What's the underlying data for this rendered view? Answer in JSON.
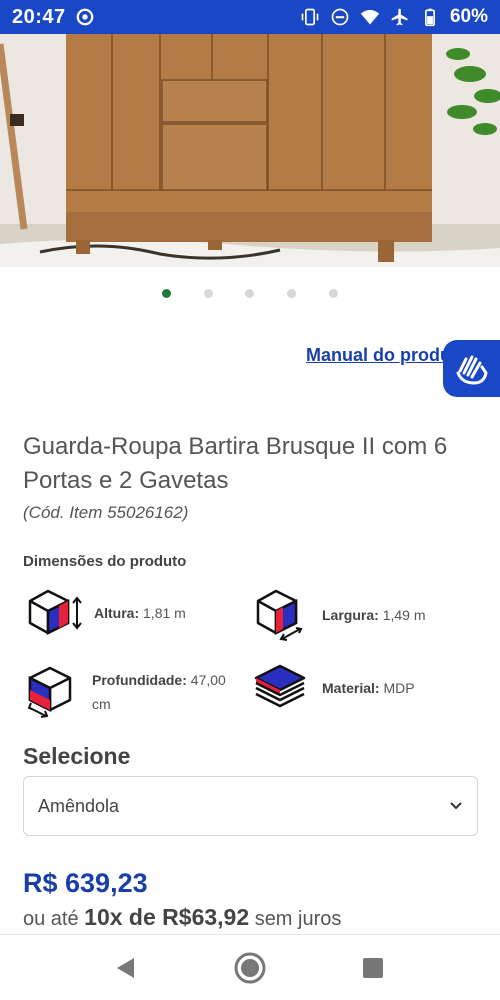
{
  "status_bar": {
    "time": "20:47",
    "battery": "60%",
    "icons": [
      "vibrate-icon",
      "dnd-icon",
      "wifi-icon",
      "airplane-icon",
      "battery-icon"
    ]
  },
  "carousel": {
    "count": 5,
    "active_index": 0
  },
  "manual_link": "Manual do produto",
  "product": {
    "title": "Guarda-Roupa Bartira Brusque II com 6 Portas e 2 Gavetas",
    "code": "(Cód. Item 55026162)"
  },
  "dimensions": {
    "heading": "Dimensões do produto",
    "height": {
      "label": "Altura:",
      "value": "1,81 m"
    },
    "width": {
      "label": "Largura:",
      "value": "1,49 m"
    },
    "depth": {
      "label": "Profundidade:",
      "value": "47,00 cm"
    },
    "material": {
      "label": "Material:",
      "value": "MDP"
    }
  },
  "selection": {
    "heading": "Selecione",
    "selected": "Amêndola"
  },
  "pricing": {
    "price": "R$ 639,23",
    "prefix": "ou até",
    "installments": "10x de R$63,92",
    "suffix": "sem juros"
  },
  "colors": {
    "brand_blue": "#1a47c6",
    "link_blue": "#1a3faa",
    "active_dot": "#1f7a3c",
    "icon_red": "#e8213a",
    "icon_blue": "#2a2fbf"
  }
}
